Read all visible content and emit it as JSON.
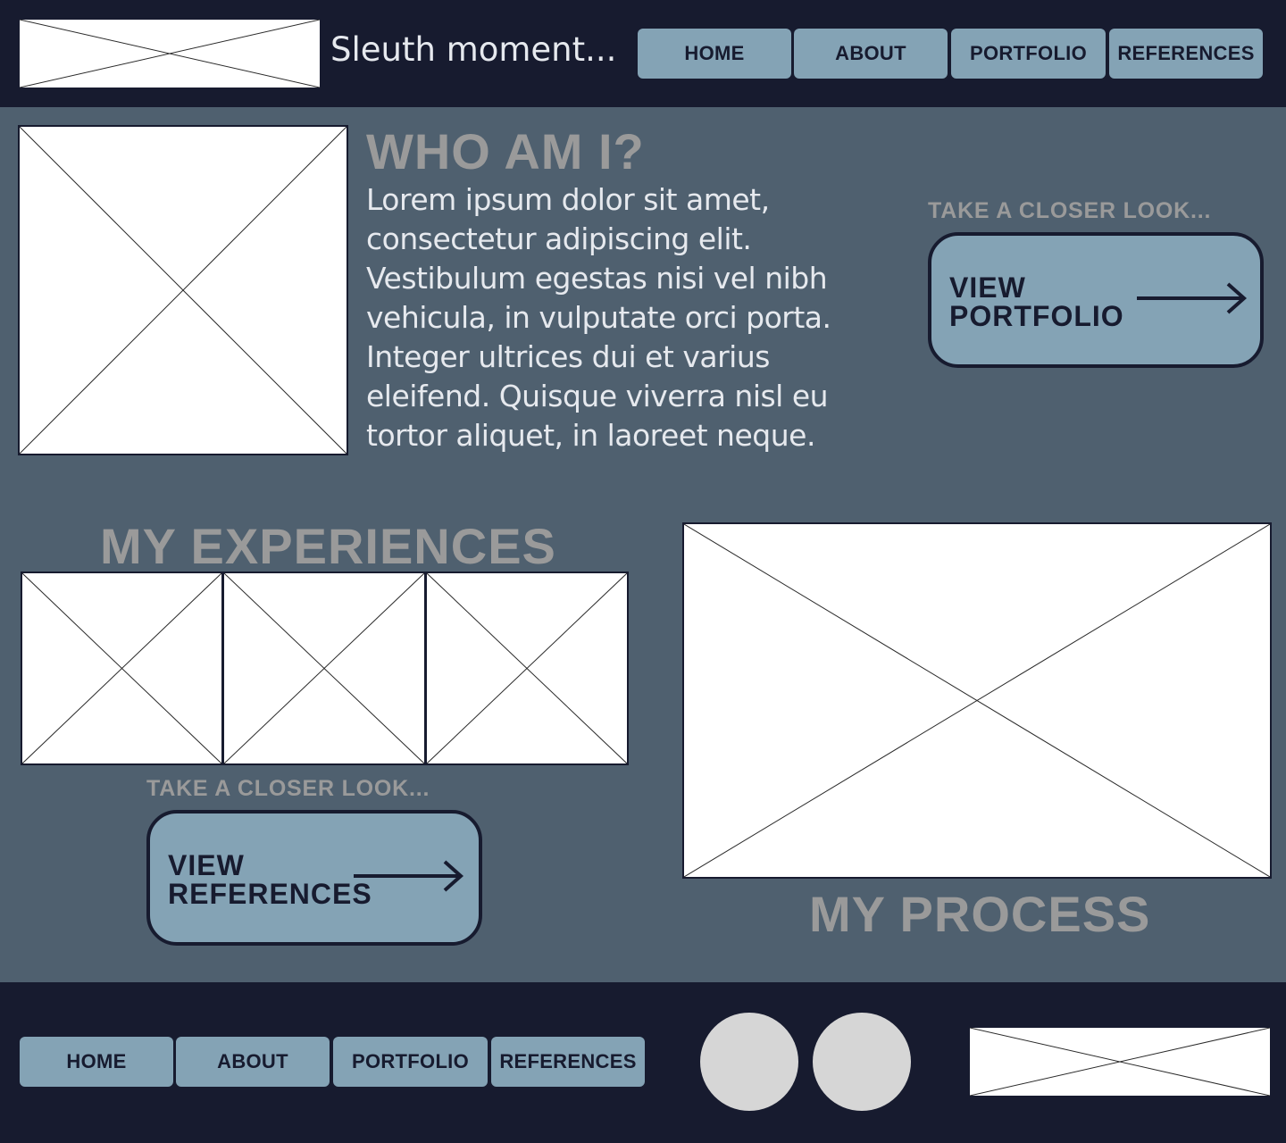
{
  "header": {
    "site_title": "Sleuth moment...",
    "nav": [
      "HOME",
      "ABOUT",
      "PORTFOLIO",
      "REFERENCES"
    ]
  },
  "about": {
    "heading": "WHO AM I?",
    "body": "Lorem ipsum dolor sit amet, consectetur adipiscing elit. Vestibulum egestas nisi vel nibh vehicula, in vulputate orci porta. Integer ultrices dui et varius eleifend. Quisque viverra nisl eu tortor aliquet, in laoreet neque."
  },
  "portfolio_cta": {
    "caption": "TAKE A CLOSER LOOK...",
    "label_line1": "VIEW",
    "label_line2": "PORTFOLIO"
  },
  "experiences": {
    "heading": "MY EXPERIENCES"
  },
  "references_cta": {
    "caption": "TAKE A CLOSER LOOK...",
    "label_line1": "VIEW",
    "label_line2": "REFERENCES"
  },
  "process": {
    "heading": "MY PROCESS"
  },
  "footer": {
    "nav": [
      "HOME",
      "ABOUT",
      "PORTFOLIO",
      "REFERENCES"
    ]
  },
  "colors": {
    "header_bg": "#171b2f",
    "main_bg": "#4f606f",
    "button_bg": "#84a3b5",
    "heading_text": "#9a9a9a",
    "body_text": "#e6e9ee"
  },
  "icons": {
    "cta_arrow": "arrow-right-icon",
    "social": [
      "social-circle-icon",
      "social-circle-icon"
    ]
  }
}
